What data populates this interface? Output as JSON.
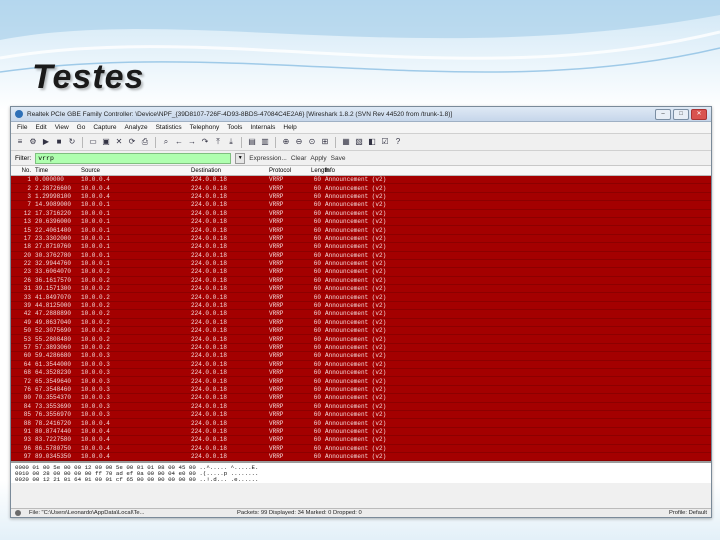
{
  "slide": {
    "title": "Testes"
  },
  "window": {
    "title": "Realtek PCIe GBE Family Controller: \\Device\\NPF_{39D8107-726F-4D93-8BDS-47084C4E2A6}   [Wireshark 1.8.2 (SVN Rev 44520 from /trunk-1.8)]",
    "buttons": [
      "–",
      "□",
      "✕"
    ]
  },
  "menu": [
    "File",
    "Edit",
    "View",
    "Go",
    "Capture",
    "Analyze",
    "Statistics",
    "Telephony",
    "Tools",
    "Internals",
    "Help"
  ],
  "toolbar_icons": [
    "list-icon",
    "gear-icon",
    "play-icon",
    "stop-icon",
    "restart-icon",
    "open-icon",
    "save-icon",
    "close-icon",
    "reload-icon",
    "print-icon",
    "find-icon",
    "back-icon",
    "forward-icon",
    "goto-icon",
    "top-icon",
    "bottom-icon",
    "colorize-icon",
    "autoscroll-icon",
    "zoom-in-icon",
    "zoom-out-icon",
    "zoom-normal-icon",
    "resize-icon",
    "capture-filter-icon",
    "display-filter-icon",
    "coloring-icon",
    "prefs-icon",
    "help-icon"
  ],
  "filter": {
    "label": "Filter:",
    "value": "vrrp",
    "actions": [
      "Expression...",
      "Clear",
      "Apply",
      "Save"
    ]
  },
  "columns": [
    "No.",
    "Time",
    "Source",
    "Destination",
    "Protocol",
    "Length",
    "Info"
  ],
  "packets": [
    {
      "no": "1",
      "time": "0.000000",
      "src": "10.0.0.4",
      "dst": "224.0.0.18",
      "proto": "VRRP",
      "len": "60",
      "info": "Announcement (v2)"
    },
    {
      "no": "2",
      "time": "2.28726600",
      "src": "10.0.0.4",
      "dst": "224.0.0.18",
      "proto": "VRRP",
      "len": "60",
      "info": "Announcement (v2)"
    },
    {
      "no": "3",
      "time": "1.29998100",
      "src": "10.0.0.4",
      "dst": "224.0.0.18",
      "proto": "VRRP",
      "len": "60",
      "info": "Announcement (v2)"
    },
    {
      "no": "7",
      "time": "14.9089000",
      "src": "10.0.0.1",
      "dst": "224.0.0.18",
      "proto": "VRRP",
      "len": "60",
      "info": "Announcement (v2)"
    },
    {
      "no": "12",
      "time": "17.3716220",
      "src": "10.0.0.1",
      "dst": "224.0.0.18",
      "proto": "VRRP",
      "len": "60",
      "info": "Announcement (v2)"
    },
    {
      "no": "13",
      "time": "20.6396000",
      "src": "10.0.0.1",
      "dst": "224.0.0.18",
      "proto": "VRRP",
      "len": "60",
      "info": "Announcement (v2)"
    },
    {
      "no": "15",
      "time": "22.4061400",
      "src": "10.0.0.1",
      "dst": "224.0.0.18",
      "proto": "VRRP",
      "len": "60",
      "info": "Announcement (v2)"
    },
    {
      "no": "17",
      "time": "23.3302000",
      "src": "10.0.0.1",
      "dst": "224.0.0.18",
      "proto": "VRRP",
      "len": "60",
      "info": "Announcement (v2)"
    },
    {
      "no": "18",
      "time": "27.8710760",
      "src": "10.0.0.1",
      "dst": "224.0.0.18",
      "proto": "VRRP",
      "len": "60",
      "info": "Announcement (v2)"
    },
    {
      "no": "20",
      "time": "30.3762780",
      "src": "10.0.0.1",
      "dst": "224.0.0.18",
      "proto": "VRRP",
      "len": "60",
      "info": "Announcement (v2)"
    },
    {
      "no": "22",
      "time": "32.9944760",
      "src": "10.0.0.1",
      "dst": "224.0.0.18",
      "proto": "VRRP",
      "len": "60",
      "info": "Announcement (v2)"
    },
    {
      "no": "23",
      "time": "33.6064070",
      "src": "10.0.0.2",
      "dst": "224.0.0.18",
      "proto": "VRRP",
      "len": "60",
      "info": "Announcement (v2)"
    },
    {
      "no": "26",
      "time": "36.1617570",
      "src": "10.0.0.2",
      "dst": "224.0.0.18",
      "proto": "VRRP",
      "len": "60",
      "info": "Announcement (v2)"
    },
    {
      "no": "31",
      "time": "39.1571300",
      "src": "10.0.0.2",
      "dst": "224.0.0.18",
      "proto": "VRRP",
      "len": "60",
      "info": "Announcement (v2)"
    },
    {
      "no": "33",
      "time": "41.8497070",
      "src": "10.0.0.2",
      "dst": "224.0.0.18",
      "proto": "VRRP",
      "len": "60",
      "info": "Announcement (v2)"
    },
    {
      "no": "39",
      "time": "44.8125000",
      "src": "10.0.0.2",
      "dst": "224.0.0.18",
      "proto": "VRRP",
      "len": "60",
      "info": "Announcement (v2)"
    },
    {
      "no": "42",
      "time": "47.2888890",
      "src": "10.0.0.2",
      "dst": "224.0.0.18",
      "proto": "VRRP",
      "len": "60",
      "info": "Announcement (v2)"
    },
    {
      "no": "49",
      "time": "49.8637040",
      "src": "10.0.0.2",
      "dst": "224.0.0.18",
      "proto": "VRRP",
      "len": "60",
      "info": "Announcement (v2)"
    },
    {
      "no": "50",
      "time": "52.3075690",
      "src": "10.0.0.2",
      "dst": "224.0.0.18",
      "proto": "VRRP",
      "len": "60",
      "info": "Announcement (v2)"
    },
    {
      "no": "53",
      "time": "55.2808480",
      "src": "10.0.0.2",
      "dst": "224.0.0.18",
      "proto": "VRRP",
      "len": "60",
      "info": "Announcement (v2)"
    },
    {
      "no": "57",
      "time": "57.3893060",
      "src": "10.0.0.2",
      "dst": "224.0.0.18",
      "proto": "VRRP",
      "len": "60",
      "info": "Announcement (v2)"
    },
    {
      "no": "60",
      "time": "59.4286680",
      "src": "10.0.0.3",
      "dst": "224.0.0.18",
      "proto": "VRRP",
      "len": "60",
      "info": "Announcement (v2)"
    },
    {
      "no": "64",
      "time": "61.3544000",
      "src": "10.0.0.3",
      "dst": "224.0.0.18",
      "proto": "VRRP",
      "len": "60",
      "info": "Announcement (v2)"
    },
    {
      "no": "68",
      "time": "64.3528230",
      "src": "10.0.0.3",
      "dst": "224.0.0.18",
      "proto": "VRRP",
      "len": "60",
      "info": "Announcement (v2)"
    },
    {
      "no": "72",
      "time": "65.3549640",
      "src": "10.0.0.3",
      "dst": "224.0.0.18",
      "proto": "VRRP",
      "len": "60",
      "info": "Announcement (v2)"
    },
    {
      "no": "76",
      "time": "67.3548460",
      "src": "10.0.0.3",
      "dst": "224.0.0.18",
      "proto": "VRRP",
      "len": "60",
      "info": "Announcement (v2)"
    },
    {
      "no": "80",
      "time": "70.3554370",
      "src": "10.0.0.3",
      "dst": "224.0.0.18",
      "proto": "VRRP",
      "len": "60",
      "info": "Announcement (v2)"
    },
    {
      "no": "84",
      "time": "73.3553690",
      "src": "10.0.0.3",
      "dst": "224.0.0.18",
      "proto": "VRRP",
      "len": "60",
      "info": "Announcement (v2)"
    },
    {
      "no": "85",
      "time": "76.3556970",
      "src": "10.0.0.3",
      "dst": "224.0.0.18",
      "proto": "VRRP",
      "len": "60",
      "info": "Announcement (v2)"
    },
    {
      "no": "88",
      "time": "78.2416720",
      "src": "10.0.0.4",
      "dst": "224.0.0.18",
      "proto": "VRRP",
      "len": "60",
      "info": "Announcement (v2)"
    },
    {
      "no": "91",
      "time": "80.8747440",
      "src": "10.0.0.4",
      "dst": "224.0.0.18",
      "proto": "VRRP",
      "len": "60",
      "info": "Announcement (v2)"
    },
    {
      "no": "93",
      "time": "83.7227580",
      "src": "10.0.0.4",
      "dst": "224.0.0.18",
      "proto": "VRRP",
      "len": "60",
      "info": "Announcement (v2)"
    },
    {
      "no": "96",
      "time": "86.5780750",
      "src": "10.0.0.4",
      "dst": "224.0.0.18",
      "proto": "VRRP",
      "len": "60",
      "info": "Announcement (v2)"
    },
    {
      "no": "97",
      "time": "89.0345350",
      "src": "10.0.0.4",
      "dst": "224.0.0.18",
      "proto": "VRRP",
      "len": "60",
      "info": "Announcement (v2)"
    },
    {
      "no": "99",
      "time": "91.4944170",
      "src": "10.0.0.4",
      "dst": "224.0.0.18",
      "proto": "VRRP",
      "len": "60",
      "info": "Announcement (v2)",
      "selected": true
    }
  ],
  "hex_lines": [
    "0000  01 00 5e 00 00 12 00 00  5e 00 01 01 08 00 45 00   ..^..... ^.....E.",
    "0010  00 28 00 00 00 00 ff 70  ad ef 0a 00 00 04 e0 00   .(.....p ........",
    "0020  00 12 21 01 64 01 00 01  cf 65 00 00 00 00 00 00   ..!.d... .e......"
  ],
  "status": {
    "file": "File: \"C:\\Users\\Leonardo\\AppData\\Local\\Te...",
    "counts": "Packets: 99 Displayed: 34 Marked: 0 Dropped: 0",
    "profile": "Profile: Default"
  },
  "colors": {
    "vrrp_row_bg": "#a40000",
    "selected_row_bg": "#3a86d9",
    "filter_valid_bg": "#afffaf"
  }
}
